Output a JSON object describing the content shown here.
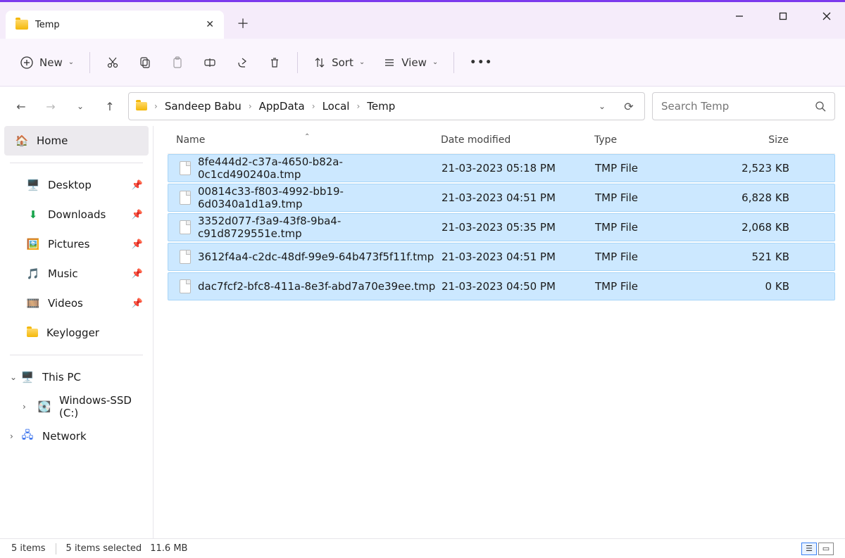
{
  "window": {
    "tab_title": "Temp"
  },
  "toolbar": {
    "new": "New",
    "sort": "Sort",
    "view": "View"
  },
  "breadcrumb": [
    "Sandeep Babu",
    "AppData",
    "Local",
    "Temp"
  ],
  "search": {
    "placeholder": "Search Temp"
  },
  "sidebar": {
    "home": "Home",
    "quick": [
      {
        "label": "Desktop"
      },
      {
        "label": "Downloads"
      },
      {
        "label": "Pictures"
      },
      {
        "label": "Music"
      },
      {
        "label": "Videos"
      },
      {
        "label": "Keylogger"
      }
    ],
    "thispc": "This PC",
    "drive": "Windows-SSD (C:)",
    "network": "Network"
  },
  "columns": {
    "name": "Name",
    "date": "Date modified",
    "type": "Type",
    "size": "Size"
  },
  "files": [
    {
      "name": "8fe444d2-c37a-4650-b82a-0c1cd490240a.tmp",
      "date": "21-03-2023 05:18 PM",
      "type": "TMP File",
      "size": "2,523 KB"
    },
    {
      "name": "00814c33-f803-4992-bb19-6d0340a1d1a9.tmp",
      "date": "21-03-2023 04:51 PM",
      "type": "TMP File",
      "size": "6,828 KB"
    },
    {
      "name": "3352d077-f3a9-43f8-9ba4-c91d8729551e.tmp",
      "date": "21-03-2023 05:35 PM",
      "type": "TMP File",
      "size": "2,068 KB"
    },
    {
      "name": "3612f4a4-c2dc-48df-99e9-64b473f5f11f.tmp",
      "date": "21-03-2023 04:51 PM",
      "type": "TMP File",
      "size": "521 KB"
    },
    {
      "name": "dac7fcf2-bfc8-411a-8e3f-abd7a70e39ee.tmp",
      "date": "21-03-2023 04:50 PM",
      "type": "TMP File",
      "size": "0 KB"
    }
  ],
  "status": {
    "count": "5 items",
    "selected": "5 items selected",
    "size": "11.6 MB"
  }
}
